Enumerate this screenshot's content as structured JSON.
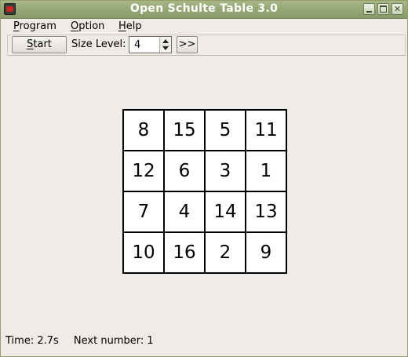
{
  "window": {
    "title": "Open Schulte Table 3.0"
  },
  "menu": {
    "program": {
      "mnemonic": "P",
      "rest": "rogram"
    },
    "option": {
      "mnemonic": "O",
      "rest": "ption"
    },
    "help": {
      "mnemonic": "H",
      "rest": "elp"
    }
  },
  "toolbar": {
    "start": {
      "mnemonic": "S",
      "rest": "tart"
    },
    "size_label": "Size Level:",
    "size_value": "4",
    "next_label": ">>"
  },
  "grid": {
    "size": 4,
    "cells": [
      8,
      15,
      5,
      11,
      12,
      6,
      3,
      1,
      7,
      4,
      14,
      13,
      10,
      16,
      2,
      9
    ]
  },
  "status": {
    "time": "Time: 2.7s",
    "next_number": "Next number: 1"
  },
  "colors": {
    "titlebar": "#95a876",
    "window_bg": "#efebe7",
    "cell_bg": "#ffffff",
    "grid_line": "#000000"
  },
  "icons": [
    "app-icon",
    "minimize-icon",
    "maximize-icon",
    "close-icon",
    "spin-up-icon",
    "spin-down-icon"
  ]
}
